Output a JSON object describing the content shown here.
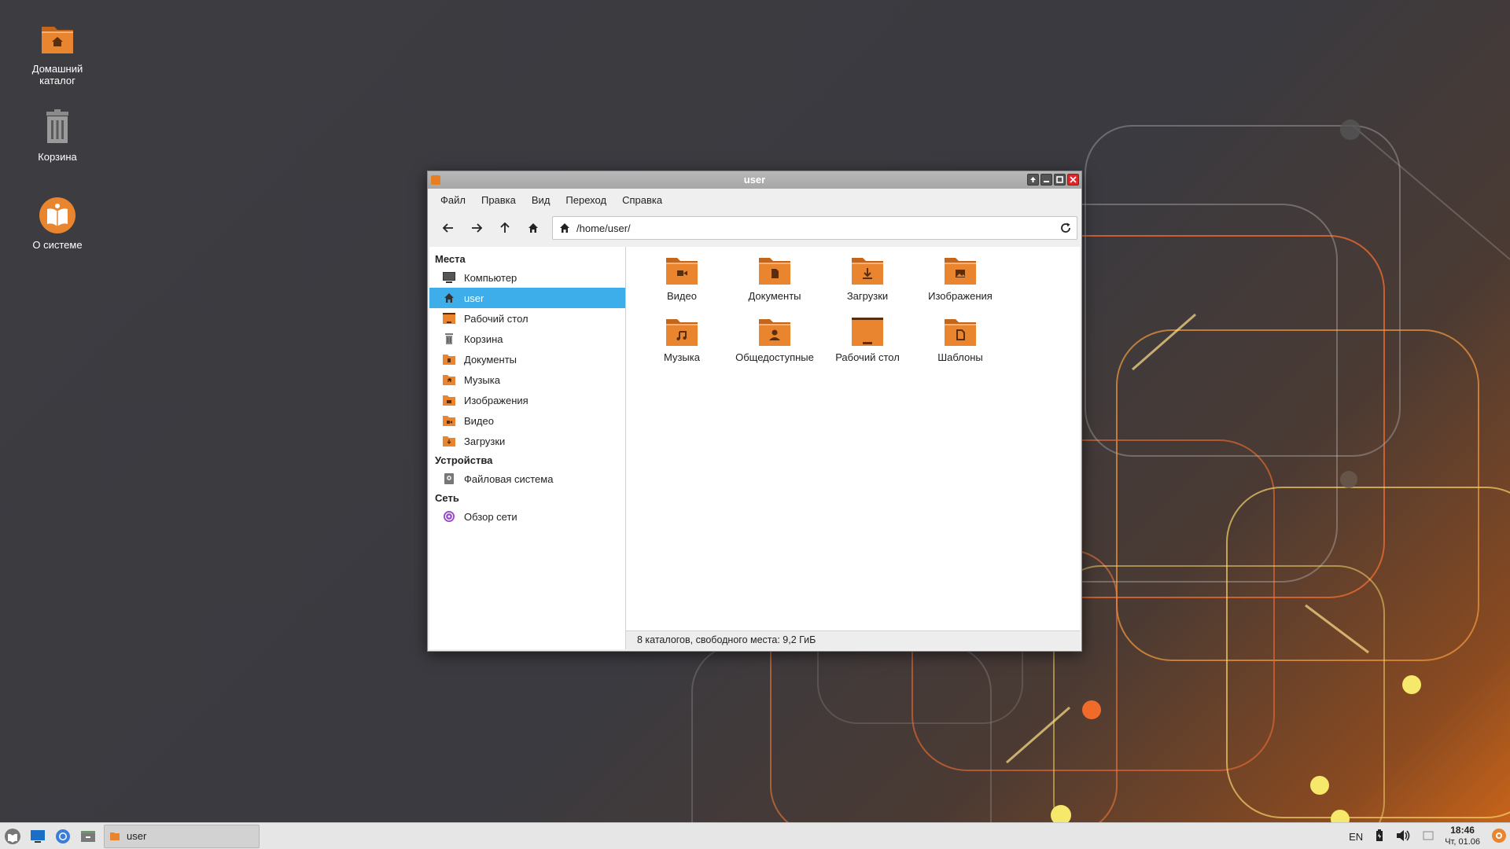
{
  "desktop": {
    "icons": [
      {
        "label": "Домашний каталог",
        "icon": "home-folder-icon"
      },
      {
        "label": "Корзина",
        "icon": "trash-icon"
      },
      {
        "label": "О системе",
        "icon": "about-system-icon"
      }
    ]
  },
  "window": {
    "title": "user",
    "menu": [
      "Файл",
      "Правка",
      "Вид",
      "Переход",
      "Справка"
    ],
    "path": "/home/user/",
    "sidebar": {
      "places_header": "Места",
      "places": [
        {
          "label": "Компьютер",
          "icon": "computer-icon"
        },
        {
          "label": "user",
          "icon": "home-icon",
          "active": true
        },
        {
          "label": "Рабочий стол",
          "icon": "desktop-folder-icon"
        },
        {
          "label": "Корзина",
          "icon": "trash-icon"
        },
        {
          "label": "Документы",
          "icon": "documents-folder-icon"
        },
        {
          "label": "Музыка",
          "icon": "music-folder-icon"
        },
        {
          "label": "Изображения",
          "icon": "pictures-folder-icon"
        },
        {
          "label": "Видео",
          "icon": "video-folder-icon"
        },
        {
          "label": "Загрузки",
          "icon": "downloads-folder-icon"
        }
      ],
      "devices_header": "Устройства",
      "devices": [
        {
          "label": "Файловая система",
          "icon": "drive-icon"
        }
      ],
      "network_header": "Сеть",
      "network": [
        {
          "label": "Обзор сети",
          "icon": "network-icon"
        }
      ]
    },
    "files": [
      {
        "label": "Видео",
        "icon": "video-folder-icon"
      },
      {
        "label": "Документы",
        "icon": "documents-folder-icon"
      },
      {
        "label": "Загрузки",
        "icon": "downloads-folder-icon"
      },
      {
        "label": "Изображения",
        "icon": "pictures-folder-icon"
      },
      {
        "label": "Музыка",
        "icon": "music-folder-icon"
      },
      {
        "label": "Общедоступные",
        "icon": "public-folder-icon"
      },
      {
        "label": "Рабочий стол",
        "icon": "desktop-folder-icon"
      },
      {
        "label": "Шаблоны",
        "icon": "templates-folder-icon"
      }
    ],
    "status": "8 каталогов, свободного места: 9,2 ГиБ"
  },
  "taskbar": {
    "task_label": "user",
    "lang": "EN",
    "time": "18:46",
    "date": "Чт, 01.06"
  },
  "colors": {
    "folder": "#e8852e",
    "folder_dark": "#c5651a",
    "selection": "#3daee9"
  }
}
